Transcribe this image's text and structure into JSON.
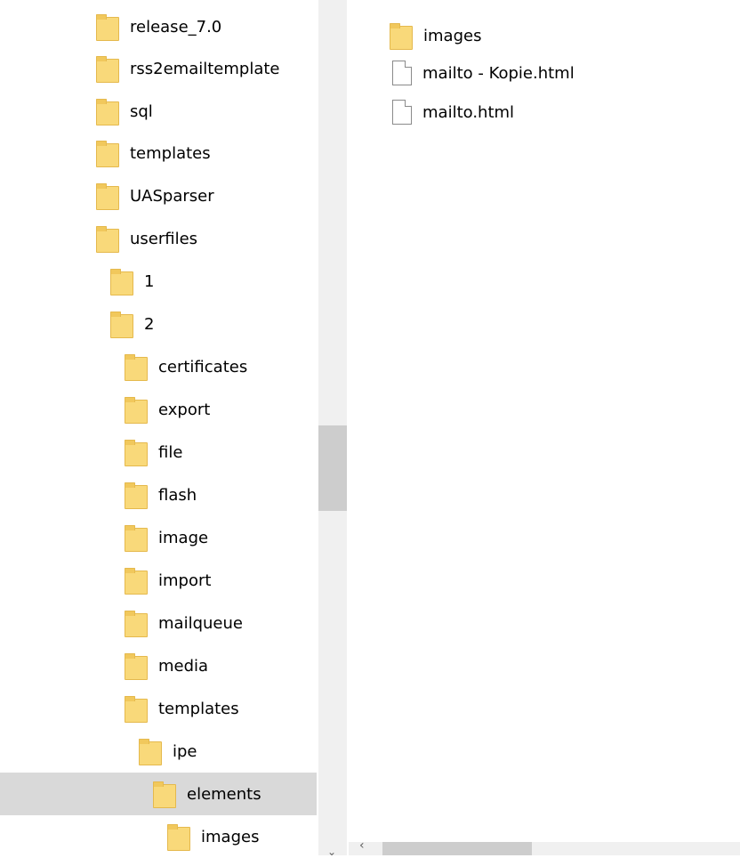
{
  "tree": {
    "items": [
      {
        "label": "release_7.0"
      },
      {
        "label": "rss2emailtemplate"
      },
      {
        "label": "sql"
      },
      {
        "label": "templates"
      },
      {
        "label": "UASparser"
      },
      {
        "label": "userfiles"
      },
      {
        "label": "1"
      },
      {
        "label": "2"
      },
      {
        "label": "certificates"
      },
      {
        "label": "export"
      },
      {
        "label": "file"
      },
      {
        "label": "flash"
      },
      {
        "label": "image"
      },
      {
        "label": "import"
      },
      {
        "label": "mailqueue"
      },
      {
        "label": "media"
      },
      {
        "label": "templates"
      },
      {
        "label": "ipe"
      },
      {
        "label": "elements",
        "selected": true
      },
      {
        "label": "images"
      }
    ]
  },
  "files": {
    "items": [
      {
        "label": "images",
        "icon": "folder-icon"
      },
      {
        "label": "mailto - Kopie.html",
        "icon": "html-file-icon"
      },
      {
        "label": "mailto.html",
        "icon": "html-file-icon"
      }
    ]
  },
  "scroll": {
    "down_glyph": "⌄",
    "left_glyph": "‹"
  }
}
